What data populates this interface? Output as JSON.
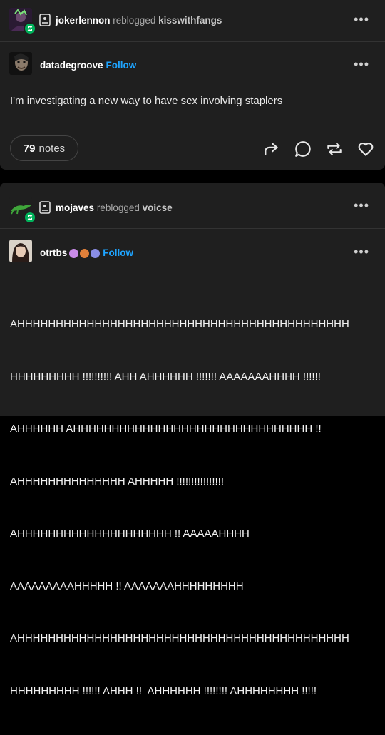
{
  "post1": {
    "reblogger": "jokerlennon",
    "reblogged_word": "reblogged",
    "source": "kisswithfangs",
    "author": "datadegroove",
    "follow": "Follow",
    "body": "I'm investigating a new way to have sex involving staplers",
    "notes_count": "79",
    "notes_label": "notes"
  },
  "post2": {
    "reblogger": "mojaves",
    "reblogged_word": "reblogged",
    "source": "voicse",
    "author": "otrtbs",
    "follow": "Follow",
    "body_lines": [
      "AHHHHHHHHHHHHHHHHHHHHHHHHHHHHHHHHHHHHHHHHHHH",
      "HHHHHHHHH !!!!!!!!!! AHH AHHHHHH !!!!!!! AAAAAAAHHHH !!!!!!",
      "AHHHHHH AHHHHHHHHHHHHHHHHHHHHHHHHHHHHHHH !!",
      "AHHHHHHHHHHHHHH AHHHHH !!!!!!!!!!!!!!!!",
      "AHHHHHHHHHHHHHHHHHHHH !! AAAAAHHHH",
      "AAAAAAAAAHHHHH !! AAAAAAAHHHHHHHHH",
      "AHHHHHHHHHHHHHHHHHHHHHHHHHHHHHHHHHHHHHHHHHHH",
      "HHHHHHHHH !!!!!! AHHH !!  AHHHHHH !!!!!!!! AHHHHHHHH !!!!!"
    ]
  },
  "colors": {
    "card": "#1f1f1f",
    "follow": "#1ea4ff",
    "reblog_badge": "#00b15a"
  },
  "icons": {
    "more": "ellipsis-icon",
    "share": "share-arrow-icon",
    "reply": "speech-bubble-icon",
    "reblog": "reblog-icon",
    "like": "heart-icon"
  }
}
